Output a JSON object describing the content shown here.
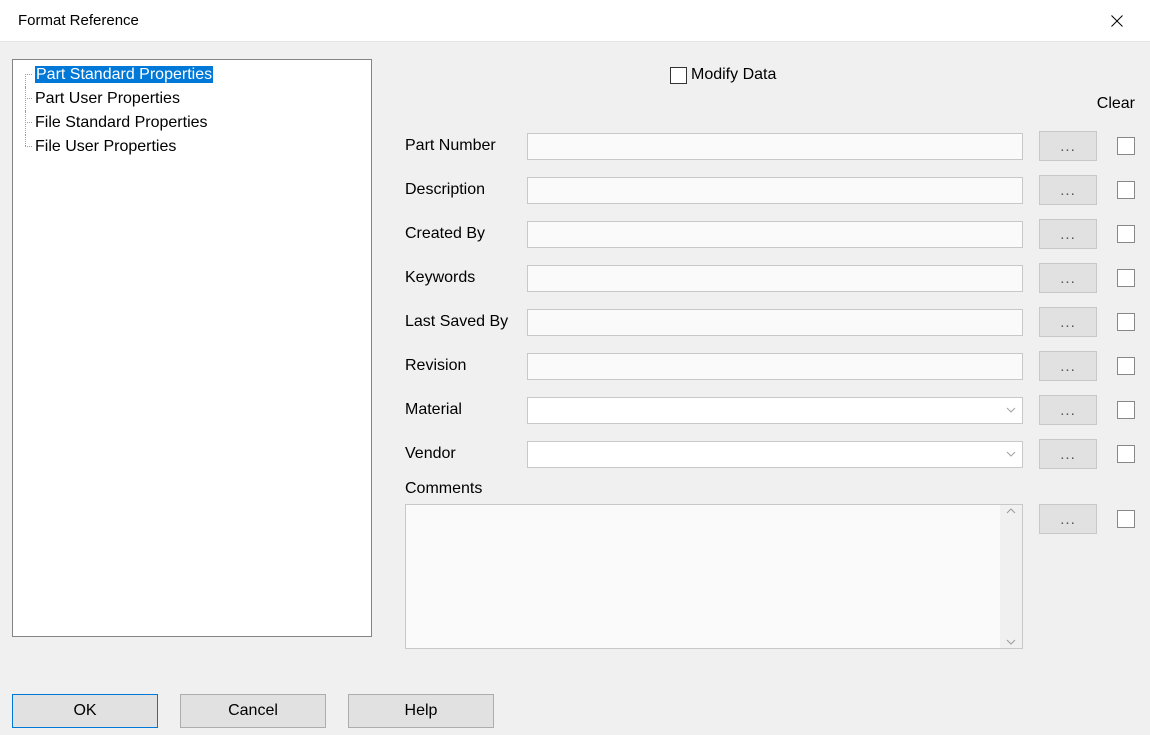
{
  "window": {
    "title": "Format Reference"
  },
  "tree": {
    "items": [
      {
        "label": "Part Standard Properties",
        "selected": true
      },
      {
        "label": "Part User Properties",
        "selected": false
      },
      {
        "label": "File Standard Properties",
        "selected": false
      },
      {
        "label": "File User Properties",
        "selected": false
      }
    ]
  },
  "modify": {
    "label": "Modify Data",
    "checked": false
  },
  "clear_header": "Clear",
  "fields": [
    {
      "label": "Part Number",
      "type": "text",
      "value": "",
      "ell": "...",
      "clear": false
    },
    {
      "label": "Description",
      "type": "text",
      "value": "",
      "ell": "...",
      "clear": false
    },
    {
      "label": "Created By",
      "type": "text",
      "value": "",
      "ell": "...",
      "clear": false
    },
    {
      "label": "Keywords",
      "type": "text",
      "value": "",
      "ell": "...",
      "clear": false
    },
    {
      "label": "Last Saved By",
      "type": "text",
      "value": "",
      "ell": "...",
      "clear": false
    },
    {
      "label": "Revision",
      "type": "text",
      "value": "",
      "ell": "...",
      "clear": false
    },
    {
      "label": "Material",
      "type": "combo",
      "value": "",
      "ell": "...",
      "clear": false
    },
    {
      "label": "Vendor",
      "type": "combo",
      "value": "",
      "ell": "...",
      "clear": false
    }
  ],
  "comments": {
    "label": "Comments",
    "value": "",
    "ell": "...",
    "clear": false
  },
  "buttons": {
    "ok": "OK",
    "cancel": "Cancel",
    "help": "Help"
  }
}
